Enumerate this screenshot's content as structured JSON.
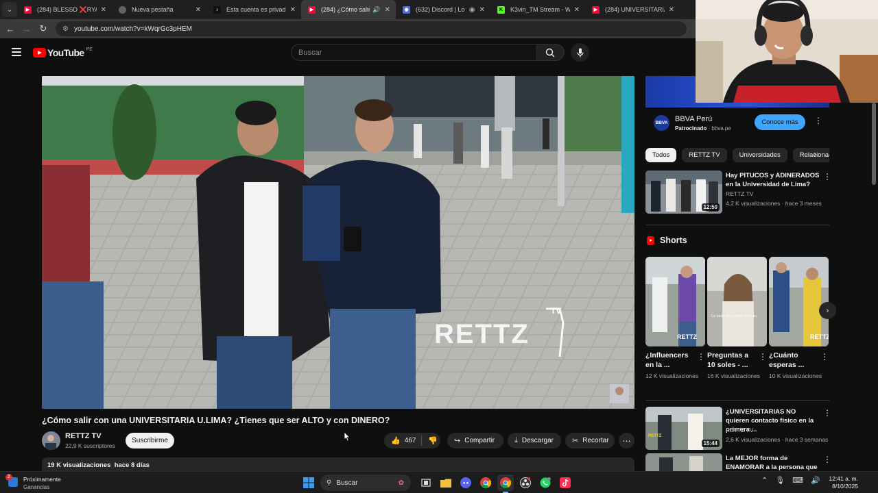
{
  "tabs": [
    {
      "title": "(284) BLESSD ❌RYAN CASTRO",
      "icon": "youtube-icon",
      "color": "#ff0033",
      "active": false
    },
    {
      "title": "Nueva pestaña",
      "icon": "chrome-icon",
      "color": "#9aa0a6",
      "active": false
    },
    {
      "title": "Esta cuenta es privada. Sigue",
      "icon": "tiktok-icon",
      "color": "#111111",
      "active": false
    },
    {
      "title": "(284) ¿Cómo salir con",
      "icon": "youtube-icon",
      "color": "#ff0033",
      "active": true
    },
    {
      "title": "(632) Discord | Lounge",
      "icon": "discord-icon",
      "color": "#5865f2",
      "active": false
    },
    {
      "title": "K3vin_TM Stream - Watch",
      "icon": "kick-icon",
      "color": "#53fc18",
      "active": false
    },
    {
      "title": "(284) UNIVERSITARIAS pone",
      "icon": "youtube-icon",
      "color": "#ff0033",
      "active": false
    }
  ],
  "address": {
    "url": "youtube.com/watch?v=kWqrGc3pHEM"
  },
  "header": {
    "logo_text": "YouTube",
    "country": "PE",
    "search_placeholder": "Buscar"
  },
  "video": {
    "title": "¿Cómo salir con una UNIVERSITARIA U.LIMA? ¿Tienes que ser ALTO y con DINERO?",
    "watermark": "RETTZ",
    "watermark_tv": "TV",
    "channel": "RETTZ TV",
    "subscribers": "22,9 K suscriptores",
    "subscribe_label": "Suscribirme",
    "likes": "467",
    "share_label": "Compartir",
    "download_label": "Descargar",
    "clip_label": "Recortar",
    "views": "19 K visualizaciones",
    "age": "hace 8 días"
  },
  "ad": {
    "name": "BBVA Perú",
    "logo": "BBVA",
    "sponsored": "Patrocinado",
    "domain": "bbva.pe",
    "cta": "Conoce más"
  },
  "chips": [
    "Todos",
    "RETTZ TV",
    "Universidades",
    "Relacionado"
  ],
  "recommendations": [
    {
      "title": "Hay PITUCOS y ADINERADOS en la Universidad de Lima?",
      "channel": "RETTZ TV",
      "meta": "4,2 K visualizaciones · hace 3 meses",
      "duration": "12:50"
    },
    {
      "title": "¿UNIVERSITARIAS NO quieren contacto físico en la primera ...",
      "channel": "RETTZ TV",
      "meta": "2,6 K visualizaciones · hace 3 semanas",
      "duration": "15:44"
    },
    {
      "title": "La MEJOR forma de ENAMORAR a la persona que t...",
      "channel": "",
      "meta": "",
      "duration": ""
    }
  ],
  "shorts": {
    "heading": "Shorts",
    "items": [
      {
        "title": "¿Influencers en la ...",
        "views": "12 K visualizaciones",
        "badge": "RETTZ"
      },
      {
        "title": "Preguntas a 10 soles - ...",
        "views": "16 K visualizaciones",
        "badge": "Le saco de cuadro mi beso"
      },
      {
        "title": "¿Cuánto esperas ...",
        "views": "10 K visualizaciones",
        "badge": "RETTZ"
      }
    ]
  },
  "taskbar": {
    "weather_title": "Próximamente",
    "weather_sub": "Ganancias",
    "search_label": "Buscar",
    "time": "12:41 a. m.",
    "date": "8/10/2025"
  }
}
